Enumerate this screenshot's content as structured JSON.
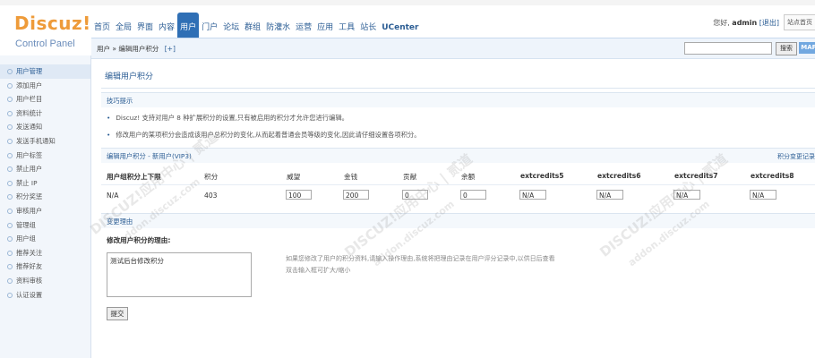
{
  "logo": {
    "brand": "Discuz!",
    "subtitle": "Control Panel"
  },
  "nav": {
    "items": [
      "首页",
      "全局",
      "界面",
      "内容",
      "用户",
      "门户",
      "论坛",
      "群组",
      "防灌水",
      "运营",
      "应用",
      "工具",
      "站长",
      "UCenter"
    ],
    "active_index": 4
  },
  "user": {
    "greeting": "您好,",
    "name": "admin",
    "logout": "[退出]",
    "site_link": "站点首页"
  },
  "breadcrumb": {
    "path": "用户 » 编辑用户积分",
    "add": "[+]"
  },
  "search": {
    "button": "搜索",
    "map_button": "MAP"
  },
  "sidebar": {
    "items": [
      "用户管理",
      "添加用户",
      "用户栏目",
      "资料统计",
      "发送通知",
      "发送手机通知",
      "用户标签",
      "禁止用户",
      "禁止 IP",
      "积分奖惩",
      "审核用户",
      "管理组",
      "用户组",
      "推荐关注",
      "推荐好友",
      "资料审核",
      "认证设置"
    ],
    "active_index": 0
  },
  "page": {
    "title": "编辑用户积分"
  },
  "tips": {
    "header": "技巧提示",
    "items": [
      "Discuz! 支持对用户 8 种扩展积分的设置,只有被启用的积分才允许您进行编辑。",
      "修改用户的某项积分会造成该用户总积分的变化,从而起着普通会员等级的变化,因此请仔细设置各项积分。"
    ]
  },
  "credits": {
    "header": "编辑用户积分 - 新用户(VIP3)",
    "header_link": "积分变更记录",
    "columns": [
      "用户组积分上下限",
      "积分",
      "威望",
      "金钱",
      "贡献",
      "余额",
      "extcredits5",
      "extcredits6",
      "extcredits7",
      "extcredits8"
    ],
    "values": {
      "range": "N/A",
      "total": "403",
      "prestige": "100",
      "money": "200",
      "contribution": "0",
      "balance": "0",
      "ext5": "N/A",
      "ext6": "N/A",
      "ext7": "N/A",
      "ext8": "N/A"
    }
  },
  "reason": {
    "section": "变更理由",
    "label": "修改用户积分的理由:",
    "value": "测试后台修改积分",
    "hint": "如果您修改了用户的积分资料,请输入操作理由,系统将把理由记录在用户评分记录中,以供日后查看",
    "hint2": "双击输入框可扩大/缩小"
  },
  "submit": {
    "label": "提交"
  },
  "watermark": {
    "text": "DISCUZ!应用中心 | 贰道",
    "url": "addon.discuz.com"
  }
}
